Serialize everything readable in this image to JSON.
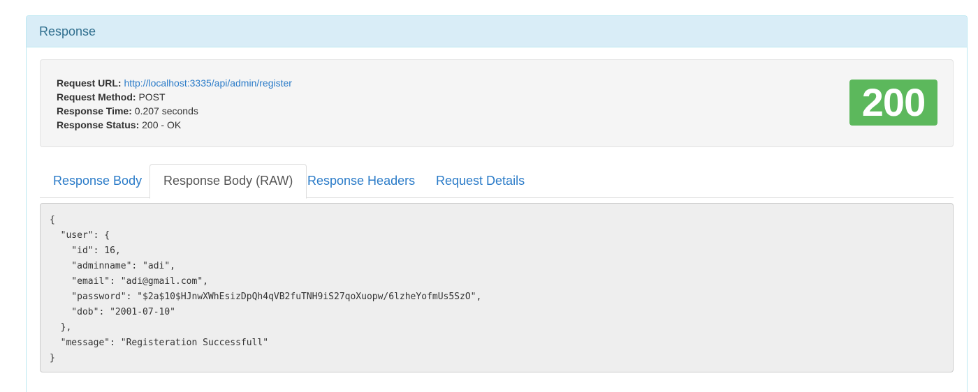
{
  "panel": {
    "title": "Response"
  },
  "request_info": {
    "url_label": "Request URL:",
    "url_value": "http://localhost:3335/api/admin/register",
    "method_label": "Request Method:",
    "method_value": "POST",
    "time_label": "Response Time:",
    "time_value": "0.207 seconds",
    "status_label": "Response Status:",
    "status_value": "200 - OK"
  },
  "status_badge": {
    "code": "200",
    "color": "#5cb85c"
  },
  "tabs": [
    {
      "label": "Response Body",
      "active": false
    },
    {
      "label": "Response Body (RAW)",
      "active": true
    },
    {
      "label": "Response Headers",
      "active": false
    },
    {
      "label": "Request Details",
      "active": false
    }
  ],
  "response_body_raw": "{\n  \"user\": {\n    \"id\": 16,\n    \"adminname\": \"adi\",\n    \"email\": \"adi@gmail.com\",\n    \"password\": \"$2a$10$HJnwXWhEsizDpQh4qVB2fuTNH9iS27qoXuopw/6lzheYofmUs5SzO\",\n    \"dob\": \"2001-07-10\"\n  },\n  \"message\": \"Registeration Successfull\"\n}",
  "colors": {
    "heading_bg": "#d9edf7",
    "heading_text": "#31708f",
    "link": "#2a7bc8",
    "success": "#5cb85c"
  }
}
